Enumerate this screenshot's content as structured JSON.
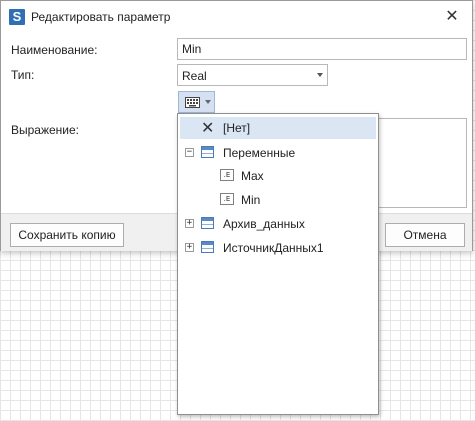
{
  "window": {
    "title": "Редактировать параметр",
    "logo_letter": "S",
    "close_glyph": "✕"
  },
  "form": {
    "name_label": "Наименование:",
    "name_value": "Min",
    "type_label": "Тип:",
    "type_value": "Real",
    "expression_label": "Выражение:"
  },
  "dropdown": {
    "none_icon_glyph": "✕",
    "none_label": "[Нет]",
    "variables_label": "Переменные",
    "variables_expander": "−",
    "var_icon_label": ".E",
    "var_max": "Max",
    "var_min": "Min",
    "archive_label": "Архив_данных",
    "archive_expander": "+",
    "source_label": "ИсточникДанных1",
    "source_expander": "+"
  },
  "footer": {
    "save_copy_label": "Сохранить копию",
    "cancel_label": "Отмена"
  },
  "colors": {
    "accent": "#2f6fb3",
    "selection": "#dbe6f5"
  },
  "icons": {
    "app": "app-logo-icon",
    "close": "close-icon",
    "expression_mode": "expression-mode-icon",
    "none": "clear-x-icon",
    "table": "table-icon",
    "variable": "variable-icon"
  }
}
